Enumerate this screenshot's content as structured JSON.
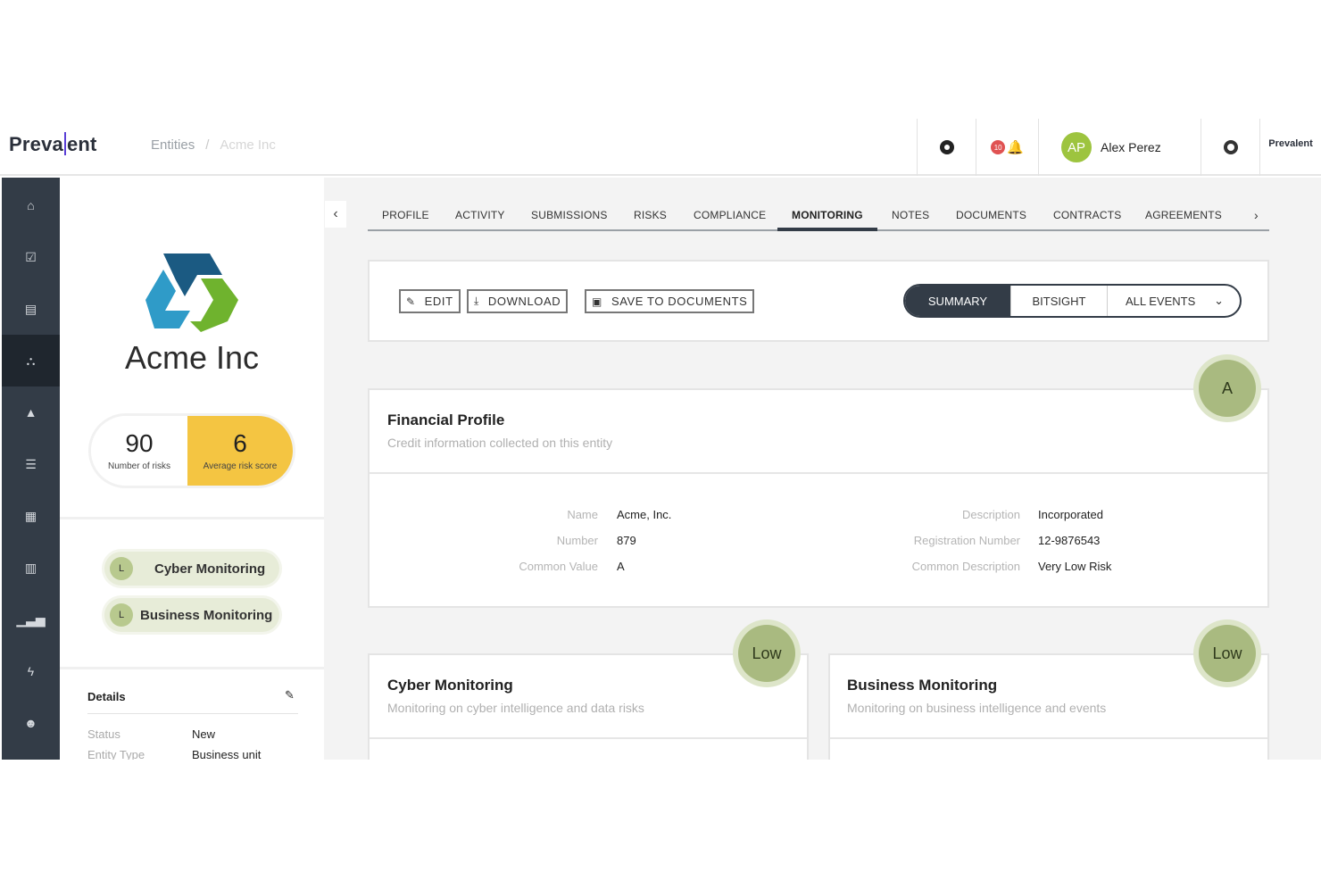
{
  "header": {
    "logo_text_a": "Preva",
    "logo_text_b": "ent",
    "breadcrumb": [
      "Entities",
      "Acme Inc"
    ],
    "badge_count": "10",
    "user_initials": "AP",
    "user_name": "Alex Perez",
    "mini_logo": "Prevalent"
  },
  "entity": {
    "name": "Acme Inc",
    "risks_count": "90",
    "risks_label": "Number of risks",
    "avg_score": "6",
    "avg_score_label": "Average risk score",
    "monitors": [
      {
        "grade": "L",
        "label": "Cyber Monitoring"
      },
      {
        "grade": "L",
        "label": "Business Monitoring"
      }
    ],
    "details_title": "Details",
    "details": [
      {
        "key": "Status",
        "value": "New"
      },
      {
        "key": "Entity Type",
        "value": "Business unit"
      }
    ]
  },
  "tabs": [
    "PROFILE",
    "ACTIVITY",
    "SUBMISSIONS",
    "RISKS",
    "COMPLIANCE",
    "MONITORING",
    "NOTES",
    "DOCUMENTS",
    "CONTRACTS",
    "AGREEMENTS"
  ],
  "active_tab": "MONITORING",
  "toolbar": {
    "edit": "EDIT",
    "download": "DOWNLOAD",
    "save": "SAVE TO DOCUMENTS",
    "views": [
      "SUMMARY",
      "BITSIGHT",
      "ALL EVENTS"
    ],
    "active_view": "SUMMARY"
  },
  "financial": {
    "grade": "A",
    "title": "Financial Profile",
    "subtitle": "Credit information collected on this entity",
    "left": [
      {
        "key": "Name",
        "value": "Acme, Inc."
      },
      {
        "key": "Number",
        "value": "879"
      },
      {
        "key": "Common Value",
        "value": "A"
      }
    ],
    "right": [
      {
        "key": "Description",
        "value": "Incorporated"
      },
      {
        "key": "Registration Number",
        "value": "12-9876543"
      },
      {
        "key": "Common Description",
        "value": "Very Low Risk"
      }
    ]
  },
  "cyber": {
    "grade": "Low",
    "title": "Cyber Monitoring",
    "subtitle": "Monitoring on cyber intelligence and data risks"
  },
  "business": {
    "grade": "Low",
    "title": "Business Monitoring",
    "subtitle": "Monitoring on business intelligence and events"
  },
  "colors": {
    "sidebar": "#333c47",
    "accent_purple": "#5a3fd6",
    "score_yellow": "#f4c542",
    "grade_green": "#a9ba80"
  },
  "icons": {
    "sidebar": [
      "dashboard-icon",
      "tasks-icon",
      "document-icon",
      "entities-icon",
      "risk-icon",
      "library-icon",
      "calendar-icon",
      "table-icon",
      "analytics-icon",
      "power-icon",
      "users-icon"
    ]
  }
}
